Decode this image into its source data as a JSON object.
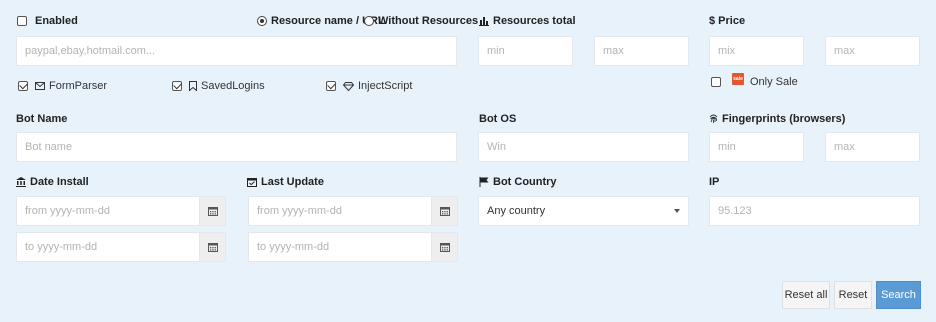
{
  "filters": {
    "enabled_label": "Enabled",
    "resource_name_label": "Resource name / URL",
    "without_resources_label": "Without Resources",
    "resources_placeholder": "paypal,ebay,hotmail.com...",
    "resources_total_label": "Resources total",
    "resources_min_placeholder": "min",
    "resources_max_placeholder": "max",
    "price_label": "$ Price",
    "price_min_placeholder": "mix",
    "price_max_placeholder": "max",
    "only_sale_label": "Only Sale",
    "form_parser_label": "FormParser",
    "saved_logins_label": "SavedLogins",
    "inject_script_label": "InjectScript",
    "bot_name_label": "Bot Name",
    "bot_name_placeholder": "Bot name",
    "bot_os_label": "Bot OS",
    "bot_os_placeholder": "Win",
    "fingerprints_label": "Fingerprints (browsers)",
    "fingerprints_min_placeholder": "min",
    "fingerprints_max_placeholder": "max",
    "date_install_label": "Date Install",
    "date_install_from_placeholder": "from yyyy-mm-dd",
    "date_install_to_placeholder": "to yyyy-mm-dd",
    "last_update_label": "Last Update",
    "last_update_from_placeholder": "from yyyy-mm-dd",
    "last_update_to_placeholder": "to yyyy-mm-dd",
    "bot_country_label": "Bot Country",
    "bot_country_value": "Any country",
    "ip_label": "IP",
    "ip_placeholder": "95.123"
  },
  "actions": {
    "reset_all_label": "Reset all",
    "reset_label": "Reset",
    "search_label": "Search"
  },
  "colors": {
    "background": "#e8f2fb",
    "primary": "#5b9bd5",
    "sale_badge": "#e4572e"
  }
}
